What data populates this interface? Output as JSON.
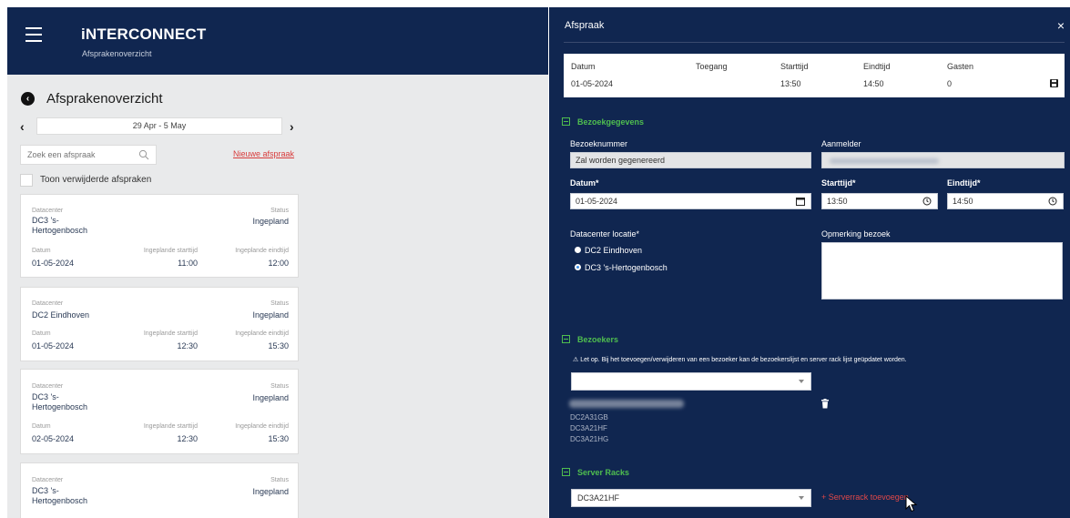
{
  "app": {
    "brand": "iNTERCONNECT",
    "brand_sub": "Afsprakenoverzicht",
    "page_title": "Afsprakenoverzicht",
    "week_range": "29 Apr - 5 May",
    "search_placeholder": "Zoek een afspraak",
    "new_appointment": "Nieuwe afspraak",
    "show_deleted": "Toon verwijderde afspraken",
    "cards": [
      {
        "datacenter_label": "Datacenter",
        "datacenter": "DC3 's-\nHertogenbosch",
        "status_label": "Status",
        "status": "Ingepland",
        "date_label": "Datum",
        "date": "01-05-2024",
        "start_label": "Ingeplande starttijd",
        "start": "11:00",
        "end_label": "Ingeplande eindtijd",
        "end": "12:00"
      },
      {
        "datacenter_label": "Datacenter",
        "datacenter": "DC2 Eindhoven",
        "status_label": "Status",
        "status": "Ingepland",
        "date_label": "Datum",
        "date": "01-05-2024",
        "start_label": "Ingeplande starttijd",
        "start": "12:30",
        "end_label": "Ingeplande eindtijd",
        "end": "15:30"
      },
      {
        "datacenter_label": "Datacenter",
        "datacenter": "DC3 's-\nHertogenbosch",
        "status_label": "Status",
        "status": "Ingepland",
        "date_label": "Datum",
        "date": "02-05-2024",
        "start_label": "Ingeplande starttijd",
        "start": "12:30",
        "end_label": "Ingeplande eindtijd",
        "end": "15:30"
      },
      {
        "datacenter_label": "Datacenter",
        "datacenter": "DC3 's-\nHertogenbosch",
        "status_label": "Status",
        "status": "Ingepland"
      }
    ]
  },
  "panel": {
    "title": "Afspraak",
    "close": "×",
    "summary": {
      "datum_label": "Datum",
      "datum": "01-05-2024",
      "toegang_label": "Toegang",
      "start_label": "Starttijd",
      "start": "13:50",
      "end_label": "Eindtijd",
      "end": "14:50",
      "guests_label": "Gasten",
      "guests": "0"
    },
    "visit_section": "Bezoekgegevens",
    "visit_number_label": "Bezoeknummer",
    "visit_number": "Zal worden gegenereerd",
    "reporter_label": "Aanmelder",
    "date_label": "Datum*",
    "date": "01-05-2024",
    "start_label": "Starttijd*",
    "start": "13:50",
    "end_label": "Eindtijd*",
    "end": "14:50",
    "location_label": "Datacenter locatie*",
    "locations": [
      "DC2 Eindhoven",
      "DC3 's-Hertogenbosch"
    ],
    "remark_label": "Opmerking bezoek",
    "visitors_section": "Bezoekers",
    "warning": "⚠ Let op. Bij het toevoegen/verwijderen van een bezoeker kan de bezoekerslijst en server rack lijst geüpdatet worden.",
    "visitor_racks": [
      "DC2A31GB",
      "DC3A21HF",
      "DC3A21HG"
    ],
    "racks_section": "Server Racks",
    "rack_selected": "DC3A21HF",
    "add_rack": "+ Serverrack toevoegen"
  }
}
